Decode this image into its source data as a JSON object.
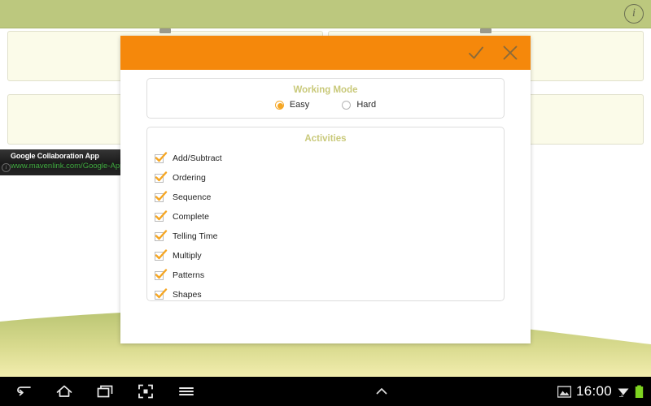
{
  "app": {
    "topbar": {
      "info_icon": "info-icon"
    },
    "background_cards": [
      {
        "id": "card-1"
      },
      {
        "id": "card-2"
      },
      {
        "id": "card-3"
      },
      {
        "id": "card-4"
      }
    ]
  },
  "ad": {
    "title": "Google Collaboration App",
    "url": "www.mavenlink.com/Google-Apps",
    "info_icon": "ad-info-icon"
  },
  "dialog": {
    "header": {
      "confirm_icon": "check-icon",
      "cancel_icon": "close-icon",
      "background_color": "#f5880b",
      "icon_color": "#8a6a3a"
    },
    "working_mode": {
      "title": "Working Mode",
      "options": [
        {
          "label": "Easy",
          "selected": true
        },
        {
          "label": "Hard",
          "selected": false
        }
      ]
    },
    "activities": {
      "title": "Activities",
      "items": [
        {
          "label": "Add/Subtract",
          "checked": true
        },
        {
          "label": "Ordering",
          "checked": true
        },
        {
          "label": "Sequence",
          "checked": true
        },
        {
          "label": "Complete",
          "checked": true
        },
        {
          "label": "Telling Time",
          "checked": true
        },
        {
          "label": "Multiply",
          "checked": true
        },
        {
          "label": "Patterns",
          "checked": true
        },
        {
          "label": "Shapes",
          "checked": true
        }
      ]
    }
  },
  "navbar": {
    "buttons": [
      {
        "name": "back-icon"
      },
      {
        "name": "home-icon"
      },
      {
        "name": "recents-icon"
      },
      {
        "name": "screenshot-icon"
      },
      {
        "name": "menu-icon"
      }
    ],
    "center": {
      "name": "chevron-up-icon"
    },
    "status": {
      "image_icon": "image-icon",
      "clock": "16:00",
      "wifi_icon": "wifi-icon",
      "battery_icon": "battery-icon",
      "battery_color": "#7ed321"
    }
  },
  "colors": {
    "accent_orange": "#f5880b",
    "check_orange": "#f5a623",
    "panel_title": "#c9c97a",
    "topbar_green": "#bcc87e",
    "card_cream": "#fbfbe9"
  }
}
